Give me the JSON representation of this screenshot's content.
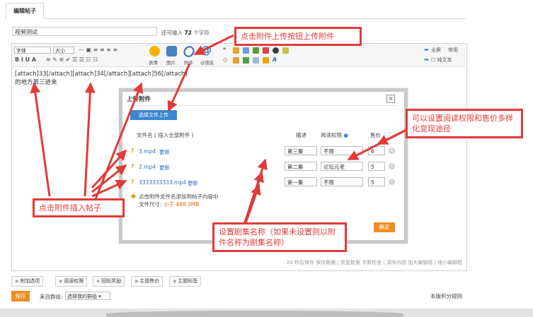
{
  "tab": {
    "label": "编辑帖子"
  },
  "title": {
    "value": "视频测试",
    "hint_prefix": "还可输入",
    "hint_count": "72",
    "hint_suffix": "个字符"
  },
  "toolbar": {
    "font_select": "字体",
    "size_select": "大小",
    "format_glyphs": "B I U A",
    "big_icons": [
      {
        "label": "表情",
        "icon": "smiley-icon",
        "color": "#f5b400"
      },
      {
        "label": "图片",
        "icon": "image-icon",
        "color": "#4a7fc0"
      },
      {
        "label": "附件",
        "icon": "paperclip-icon",
        "color": "#3a6db8"
      },
      {
        "label": "@朋友",
        "icon": "at-icon",
        "color": "#2a78d0"
      }
    ],
    "right_labels": {
      "fullscreen": "全屏",
      "common": "常用",
      "plaintext": "纯文本"
    }
  },
  "editor": {
    "content_line1": "[attach]33[/attach][attach]34[/attach][attach]56[/attach]",
    "content_line2": "的地方第三",
    "content_line2b": "进来",
    "status_text": "20 秒后保存 保存数据 | 恢复数据   字数检查 | 清除内容   加大编辑框 | 缩小编辑框"
  },
  "dialog": {
    "title": "上传附件",
    "close": "×",
    "select_button": "选择文件上传",
    "headers": {
      "filename": "文件名 ( 插入全部附件 )",
      "desc": "描述",
      "perm": "阅读权限",
      "price": "售价"
    },
    "rows": [
      {
        "file": "3.mp4",
        "update": "更新",
        "desc": "第三集",
        "perm": "不限",
        "price": "6"
      },
      {
        "file": "2.mp4",
        "update": "更新",
        "desc": "第二集",
        "perm": "论坛元老",
        "price": "5"
      },
      {
        "file": "3333333333.mp4",
        "update": "更新",
        "desc": "第一集",
        "perm": "不限",
        "price": "5"
      }
    ],
    "tip_line1": "点击附件文件名添加到帖子内容中",
    "tip_size_label": "文件尺寸:",
    "tip_size_value": "小于 488.3MB",
    "confirm": "确定"
  },
  "options": [
    "附加选项",
    "阅读权限",
    "回帖奖励",
    "主题售价",
    "主题标签"
  ],
  "bottom": {
    "post_button": "保存",
    "group_label": "来自群组:",
    "group_select": "选择我的群组",
    "rules_link": "本版积分规则"
  },
  "callouts": {
    "upload": "点击附件上传按钮上传附件",
    "perm": "可以设置阅读权限和售价多样化变现途径",
    "insert": "点击附件插入帖子",
    "episode": "设置剧集名称（如果未设置则以附件名称为剧集名称）"
  },
  "colors": {
    "accent_blue": "#3a87d0",
    "accent_orange": "#f08c22",
    "callout_red": "#e33a3a"
  }
}
